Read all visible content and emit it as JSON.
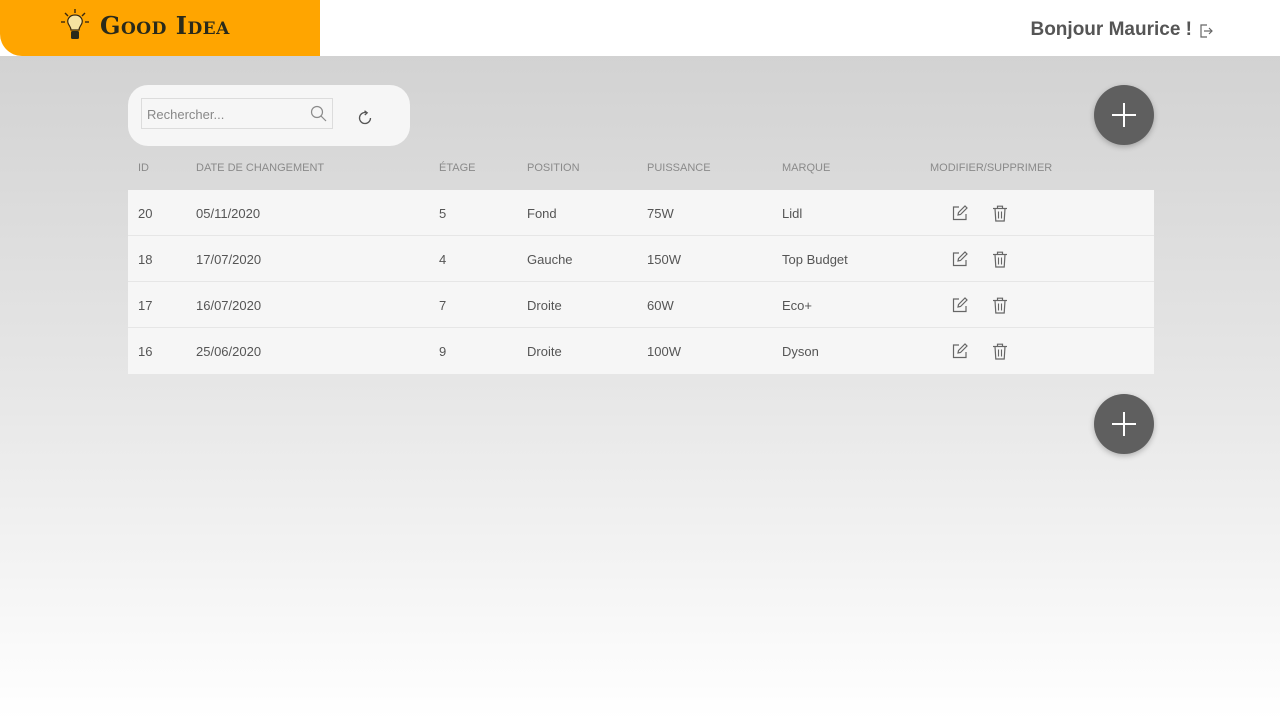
{
  "header": {
    "logo_text": "Good Idea",
    "greeting": "Bonjour Maurice !",
    "logo_color": "#ffa500"
  },
  "search": {
    "placeholder": "Rechercher...",
    "value": ""
  },
  "table": {
    "columns": [
      "ID",
      "DATE DE CHANGEMENT",
      "ÉTAGE",
      "POSITION",
      "PUISSANCE",
      "MARQUE",
      "MODIFIER/SUPPRIMER"
    ],
    "rows": [
      {
        "id": "20",
        "date": "05/11/2020",
        "etage": "5",
        "position": "Fond",
        "puissance": "75W",
        "marque": "Lidl"
      },
      {
        "id": "18",
        "date": "17/07/2020",
        "etage": "4",
        "position": "Gauche",
        "puissance": "150W",
        "marque": "Top Budget"
      },
      {
        "id": "17",
        "date": "16/07/2020",
        "etage": "7",
        "position": "Droite",
        "puissance": "60W",
        "marque": "Eco+"
      },
      {
        "id": "16",
        "date": "25/06/2020",
        "etage": "9",
        "position": "Droite",
        "puissance": "100W",
        "marque": "Dyson"
      }
    ]
  },
  "icons": {
    "logo": "lightbulb-icon",
    "logout": "logout-icon",
    "search": "search-icon",
    "refresh": "refresh-icon",
    "add": "plus-icon",
    "edit": "edit-icon",
    "delete": "trash-icon"
  }
}
